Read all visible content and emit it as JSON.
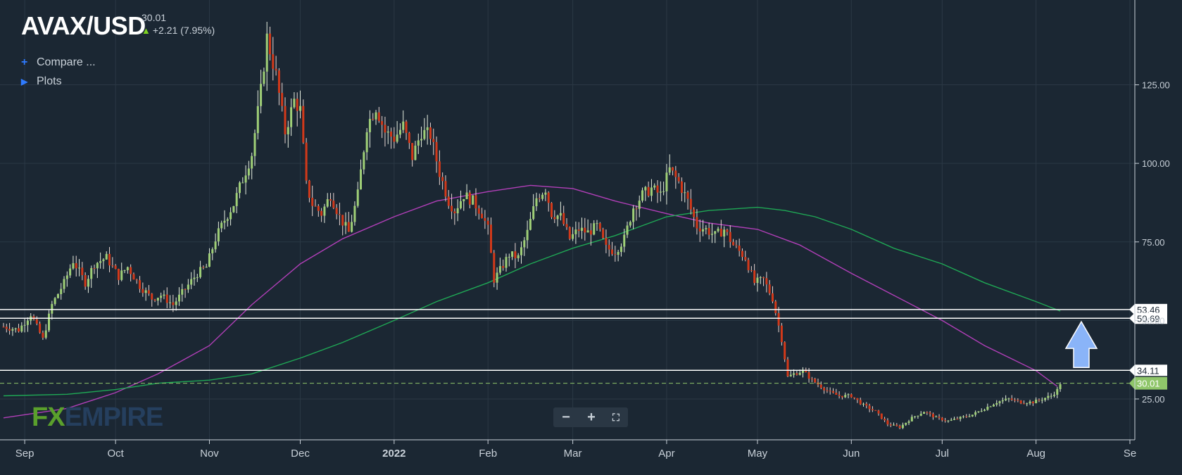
{
  "header": {
    "symbol": "AVAX/USD",
    "last_price": "30.01",
    "change": "+2.21 (7.95%)",
    "up_color": "#7ed321"
  },
  "menu": {
    "compare_label": "Compare ...",
    "plots_label": "Plots"
  },
  "zoom": {
    "minus": "−",
    "plus": "+",
    "fullscreen": "⛶"
  },
  "logo": {
    "fx": "FX",
    "empire": "EMPIRE"
  },
  "colors": {
    "background": "#1b2733",
    "grid": "#2b3845",
    "bull": "#9fcf77",
    "bear": "#d2391a",
    "ma_short": "#b13fb8",
    "ma_long": "#1fa855",
    "level_line": "#ffffff",
    "price_tag": "#8fc66a",
    "arrow": "#8ab4f8"
  },
  "chart_data": {
    "type": "candlestick",
    "title": "AVAX/USD",
    "y_ticks": [
      25,
      50,
      75,
      100,
      125
    ],
    "y_tick_labels": [
      "25.00",
      "50.00",
      "75.00",
      "100.00",
      "125.00"
    ],
    "ylim": [
      12,
      152
    ],
    "x_tick_labels": [
      "Sep",
      "Oct",
      "Nov",
      "Dec",
      "2022",
      "Feb",
      "Mar",
      "Apr",
      "May",
      "Jun",
      "Jul",
      "Aug",
      "Se"
    ],
    "x_tick_dates": [
      "2021-09-01",
      "2021-10-01",
      "2021-11-01",
      "2021-12-01",
      "2022-01-01",
      "2022-02-01",
      "2022-03-01",
      "2022-04-01",
      "2022-05-01",
      "2022-06-01",
      "2022-07-01",
      "2022-08-01",
      "2022-09-01"
    ],
    "x_range": [
      "2021-08-25",
      "2022-09-01"
    ],
    "grid": true,
    "price_anchors": [
      [
        "2021-08-25",
        48
      ],
      [
        "2021-08-30",
        47
      ],
      [
        "2021-09-03",
        52
      ],
      [
        "2021-09-07",
        44
      ],
      [
        "2021-09-10",
        55
      ],
      [
        "2021-09-14",
        62
      ],
      [
        "2021-09-17",
        69
      ],
      [
        "2021-09-21",
        62
      ],
      [
        "2021-09-24",
        68
      ],
      [
        "2021-09-28",
        70
      ],
      [
        "2021-10-02",
        64
      ],
      [
        "2021-10-05",
        67
      ],
      [
        "2021-10-09",
        61
      ],
      [
        "2021-10-13",
        57
      ],
      [
        "2021-10-16",
        58
      ],
      [
        "2021-10-20",
        55
      ],
      [
        "2021-10-24",
        60
      ],
      [
        "2021-10-28",
        65
      ],
      [
        "2021-10-31",
        67
      ],
      [
        "2021-11-03",
        76
      ],
      [
        "2021-11-06",
        82
      ],
      [
        "2021-11-09",
        87
      ],
      [
        "2021-11-12",
        95
      ],
      [
        "2021-11-15",
        103
      ],
      [
        "2021-11-18",
        123
      ],
      [
        "2021-11-20",
        140
      ],
      [
        "2021-11-23",
        128
      ],
      [
        "2021-11-26",
        110
      ],
      [
        "2021-11-29",
        120
      ],
      [
        "2021-12-01",
        117
      ],
      [
        "2021-12-03",
        93
      ],
      [
        "2021-12-05",
        87
      ],
      [
        "2021-12-08",
        84
      ],
      [
        "2021-12-11",
        90
      ],
      [
        "2021-12-14",
        83
      ],
      [
        "2021-12-17",
        78
      ],
      [
        "2021-12-20",
        90
      ],
      [
        "2021-12-23",
        112
      ],
      [
        "2021-12-26",
        118
      ],
      [
        "2021-12-29",
        110
      ],
      [
        "2022-01-01",
        108
      ],
      [
        "2022-01-04",
        112
      ],
      [
        "2022-01-07",
        102
      ],
      [
        "2022-01-10",
        110
      ],
      [
        "2022-01-13",
        109
      ],
      [
        "2022-01-16",
        97
      ],
      [
        "2022-01-19",
        88
      ],
      [
        "2022-01-21",
        85
      ],
      [
        "2022-01-24",
        90
      ],
      [
        "2022-01-27",
        88
      ],
      [
        "2022-01-30",
        84
      ],
      [
        "2022-02-01",
        79
      ],
      [
        "2022-02-03",
        63
      ],
      [
        "2022-02-05",
        66
      ],
      [
        "2022-02-08",
        71
      ],
      [
        "2022-02-11",
        70
      ],
      [
        "2022-02-14",
        78
      ],
      [
        "2022-02-17",
        89
      ],
      [
        "2022-02-20",
        92
      ],
      [
        "2022-02-22",
        84
      ],
      [
        "2022-02-25",
        83
      ],
      [
        "2022-02-28",
        76
      ],
      [
        "2022-03-03",
        79
      ],
      [
        "2022-03-06",
        78
      ],
      [
        "2022-03-09",
        80
      ],
      [
        "2022-03-12",
        73
      ],
      [
        "2022-03-15",
        72
      ],
      [
        "2022-03-18",
        76
      ],
      [
        "2022-03-21",
        86
      ],
      [
        "2022-03-24",
        90
      ],
      [
        "2022-03-27",
        92
      ],
      [
        "2022-03-30",
        90
      ],
      [
        "2022-04-02",
        98
      ],
      [
        "2022-04-05",
        94
      ],
      [
        "2022-04-08",
        88
      ],
      [
        "2022-04-11",
        80
      ],
      [
        "2022-04-14",
        79
      ],
      [
        "2022-04-17",
        77
      ],
      [
        "2022-04-20",
        79
      ],
      [
        "2022-04-23",
        74
      ],
      [
        "2022-04-27",
        70
      ],
      [
        "2022-04-30",
        62
      ],
      [
        "2022-05-03",
        63
      ],
      [
        "2022-05-06",
        57
      ],
      [
        "2022-05-09",
        44
      ],
      [
        "2022-05-11",
        32
      ],
      [
        "2022-05-13",
        33
      ],
      [
        "2022-05-16",
        34
      ],
      [
        "2022-05-19",
        31
      ],
      [
        "2022-05-22",
        29
      ],
      [
        "2022-05-25",
        27
      ],
      [
        "2022-05-28",
        26
      ],
      [
        "2022-06-01",
        26
      ],
      [
        "2022-06-05",
        23
      ],
      [
        "2022-06-09",
        21
      ],
      [
        "2022-06-13",
        17
      ],
      [
        "2022-06-17",
        16
      ],
      [
        "2022-06-21",
        19
      ],
      [
        "2022-06-25",
        21
      ],
      [
        "2022-06-29",
        19
      ],
      [
        "2022-07-03",
        18
      ],
      [
        "2022-07-07",
        19
      ],
      [
        "2022-07-11",
        20
      ],
      [
        "2022-07-15",
        22
      ],
      [
        "2022-07-19",
        24
      ],
      [
        "2022-07-23",
        25
      ],
      [
        "2022-07-27",
        24
      ],
      [
        "2022-07-31",
        24
      ],
      [
        "2022-08-03",
        25
      ],
      [
        "2022-08-06",
        26
      ],
      [
        "2022-08-08",
        27.8
      ],
      [
        "2022-08-09",
        30.01
      ]
    ],
    "series": [
      {
        "name": "",
        "kind": "moving-average",
        "color": "#b13fb8",
        "points": [
          [
            "2021-08-25",
            19
          ],
          [
            "2021-09-15",
            22
          ],
          [
            "2021-10-01",
            27
          ],
          [
            "2021-10-15",
            33
          ],
          [
            "2021-11-01",
            42
          ],
          [
            "2021-11-15",
            55
          ],
          [
            "2021-12-01",
            68
          ],
          [
            "2021-12-15",
            76
          ],
          [
            "2022-01-01",
            83
          ],
          [
            "2022-01-15",
            88
          ],
          [
            "2022-02-01",
            91
          ],
          [
            "2022-02-15",
            93
          ],
          [
            "2022-03-01",
            92
          ],
          [
            "2022-03-15",
            88
          ],
          [
            "2022-04-01",
            84
          ],
          [
            "2022-04-15",
            81
          ],
          [
            "2022-05-01",
            79
          ],
          [
            "2022-05-15",
            74
          ],
          [
            "2022-06-01",
            65
          ],
          [
            "2022-06-15",
            58
          ],
          [
            "2022-07-01",
            50
          ],
          [
            "2022-07-15",
            42
          ],
          [
            "2022-08-01",
            34
          ],
          [
            "2022-08-08",
            29
          ]
        ]
      },
      {
        "name": "",
        "kind": "moving-average",
        "color": "#1fa855",
        "points": [
          [
            "2021-08-25",
            26
          ],
          [
            "2021-09-15",
            26.5
          ],
          [
            "2021-10-01",
            28
          ],
          [
            "2021-10-15",
            30
          ],
          [
            "2021-11-01",
            31
          ],
          [
            "2021-11-15",
            33
          ],
          [
            "2021-12-01",
            38
          ],
          [
            "2021-12-15",
            43
          ],
          [
            "2022-01-01",
            50
          ],
          [
            "2022-01-15",
            56
          ],
          [
            "2022-02-01",
            62
          ],
          [
            "2022-02-15",
            68
          ],
          [
            "2022-03-01",
            73
          ],
          [
            "2022-03-15",
            77
          ],
          [
            "2022-04-01",
            83
          ],
          [
            "2022-04-15",
            85
          ],
          [
            "2022-05-01",
            86
          ],
          [
            "2022-05-10",
            85
          ],
          [
            "2022-05-20",
            83
          ],
          [
            "2022-06-01",
            79
          ],
          [
            "2022-06-15",
            73
          ],
          [
            "2022-07-01",
            68
          ],
          [
            "2022-07-15",
            62
          ],
          [
            "2022-08-01",
            56
          ],
          [
            "2022-08-09",
            53
          ]
        ]
      }
    ],
    "levels": [
      53.46,
      50.69,
      34.11
    ],
    "level_labels": [
      "53.46",
      "50.69",
      "34.11"
    ],
    "current_price": 30.01,
    "current_price_label": "30.01",
    "annotation": "upward arrow pointing to 50.69–53.46 resistance"
  }
}
